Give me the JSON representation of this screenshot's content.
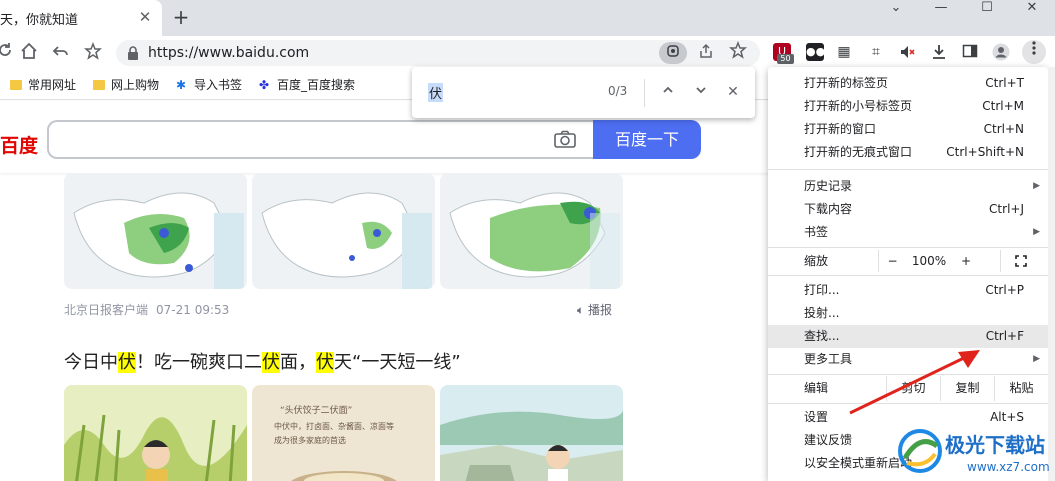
{
  "tab": {
    "title": "天，你就知道",
    "close": "✕",
    "new_tab": "+"
  },
  "window": {
    "minimize": "—",
    "maximize": "☐",
    "close": "✕",
    "dropdown": "⌄"
  },
  "toolbar": {
    "url": "https://www.baidu.com",
    "extension_badge": "50"
  },
  "bookmarks": [
    {
      "label": "常用网址",
      "icon": "folder-icon"
    },
    {
      "label": "网上购物",
      "icon": "folder-icon"
    },
    {
      "label": "导入书签",
      "icon": "gear-icon"
    },
    {
      "label": "百度_百度搜索",
      "icon": "baidu-paw-icon"
    }
  ],
  "page": {
    "logo": "百度",
    "search_button": "百度一下",
    "source": "北京日报客户端",
    "time": "07-21 09:53",
    "broadcast": "播报",
    "headline_parts": [
      "今日中",
      "伏",
      "！吃一碗爽口二",
      "伏",
      "面，",
      "伏",
      "天“一天短一线”"
    ]
  },
  "findbar": {
    "query": "伏",
    "count": "0/3",
    "up": "∧",
    "down": "∨",
    "close": "✕"
  },
  "menu": {
    "items": [
      {
        "label": "打开新的标签页",
        "shortcut": "Ctrl+T"
      },
      {
        "label": "打开新的小号标签页",
        "shortcut": "Ctrl+M"
      },
      {
        "label": "打开新的窗口",
        "shortcut": "Ctrl+N"
      },
      {
        "label": "打开新的无痕式窗口",
        "shortcut": "Ctrl+Shift+N"
      },
      {
        "label": "历史记录",
        "shortcut": ""
      },
      {
        "label": "下载内容",
        "shortcut": "Ctrl+J"
      },
      {
        "label": "书签",
        "shortcut": ""
      },
      {
        "label": "打印...",
        "shortcut": "Ctrl+P"
      },
      {
        "label": "投射...",
        "shortcut": ""
      },
      {
        "label": "查找...",
        "shortcut": "Ctrl+F"
      },
      {
        "label": "更多工具",
        "shortcut": ""
      },
      {
        "label": "设置",
        "shortcut": "Alt+S"
      },
      {
        "label": "建议反馈",
        "shortcut": ""
      },
      {
        "label": "以安全模式重新启动",
        "shortcut": ""
      }
    ],
    "zoom": {
      "label": "缩放",
      "minus": "−",
      "value": "100%",
      "plus": "+"
    },
    "edit": {
      "label": "编辑",
      "cut": "剪切",
      "copy": "复制",
      "paste": "粘贴"
    }
  },
  "watermark": {
    "name": "极光下载站",
    "url": "www.xz7.com"
  }
}
